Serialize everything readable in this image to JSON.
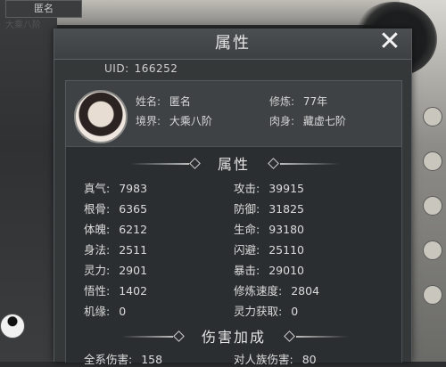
{
  "background": {
    "player_name_tag": "匿名",
    "player_realm_tag": "大乘八阶"
  },
  "dialog": {
    "title": "属性",
    "close_icon": "close-icon"
  },
  "uid": {
    "label": "UID:",
    "value": "166252"
  },
  "profile": {
    "name_label": "姓名:",
    "name_value": "匿名",
    "cultivate_label": "修炼:",
    "cultivate_value": "77年",
    "realm_label": "境界:",
    "realm_value": "大乘八阶",
    "body_label": "肉身:",
    "body_value": "藏虚七阶"
  },
  "attributes": {
    "title": "属性",
    "left": [
      {
        "label": "真气:",
        "value": "7983"
      },
      {
        "label": "根骨:",
        "value": "6365"
      },
      {
        "label": "体魄:",
        "value": "6212"
      },
      {
        "label": "身法:",
        "value": "2511"
      },
      {
        "label": "灵力:",
        "value": "2901"
      },
      {
        "label": "悟性:",
        "value": "1402"
      },
      {
        "label": "机缘:",
        "value": "0"
      }
    ],
    "right": [
      {
        "label": "攻击:",
        "value": "39915"
      },
      {
        "label": "防御:",
        "value": "31825"
      },
      {
        "label": "生命:",
        "value": "93180"
      },
      {
        "label": "闪避:",
        "value": "25110"
      },
      {
        "label": "暴击:",
        "value": "29010"
      },
      {
        "label": "修炼速度:",
        "value": "2804"
      },
      {
        "label": "灵力获取:",
        "value": "0"
      }
    ]
  },
  "damage_bonus": {
    "title": "伤害加成",
    "left": {
      "label": "全系伤害:",
      "value": "158"
    },
    "right": {
      "label": "对人族伤害:",
      "value": "80"
    }
  }
}
